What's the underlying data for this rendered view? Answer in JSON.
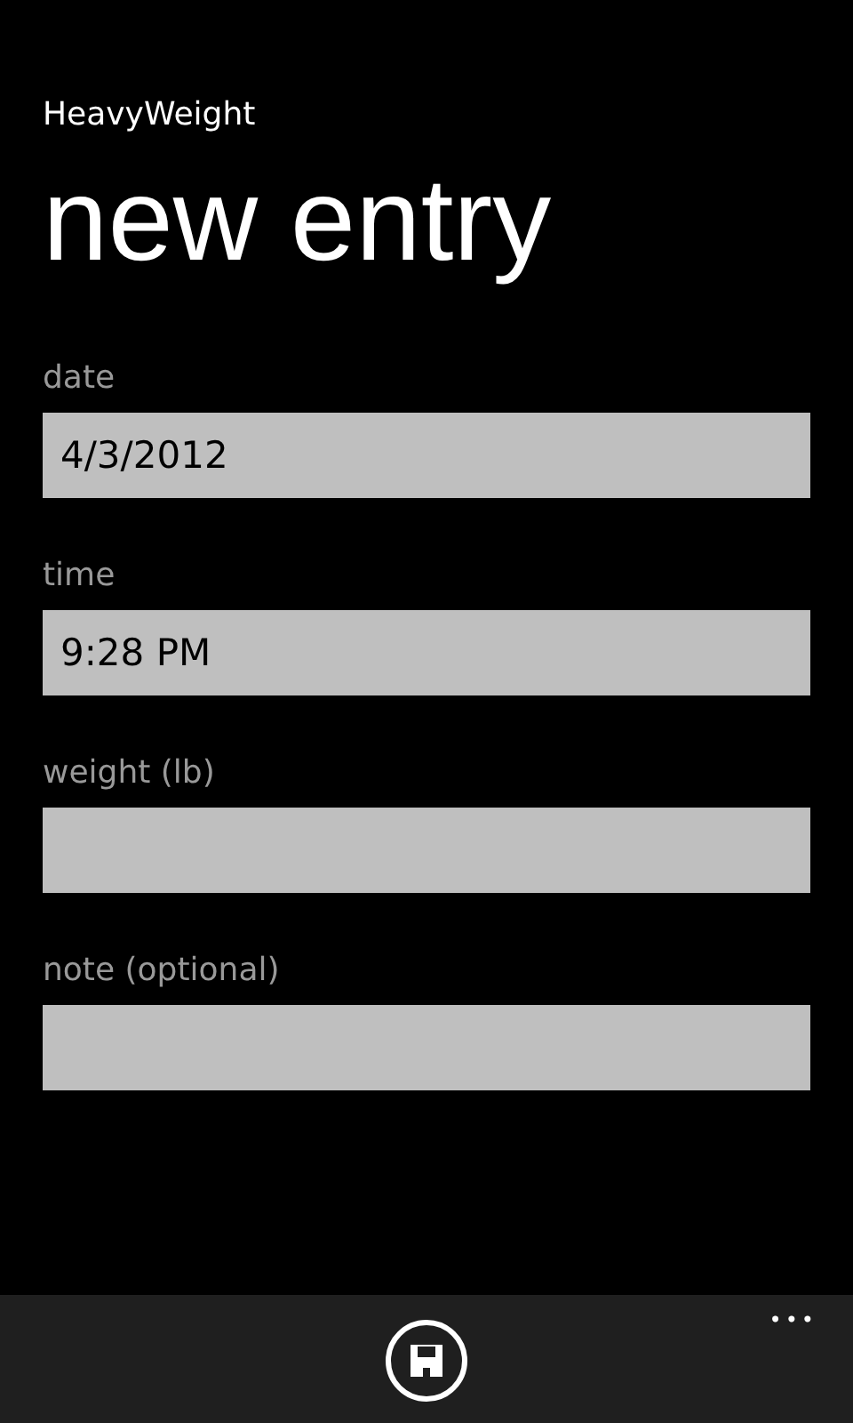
{
  "app_title": "HeavyWeight",
  "page_title": "new entry",
  "fields": [
    {
      "label": "date",
      "value": "4/3/2012"
    },
    {
      "label": "time",
      "value": "9:28 PM"
    },
    {
      "label": "weight (lb)"
    },
    {
      "label": "note (optional)"
    }
  ],
  "app_bar": {
    "buttons": [
      {
        "kind": "save"
      }
    ],
    "more": "•••"
  }
}
